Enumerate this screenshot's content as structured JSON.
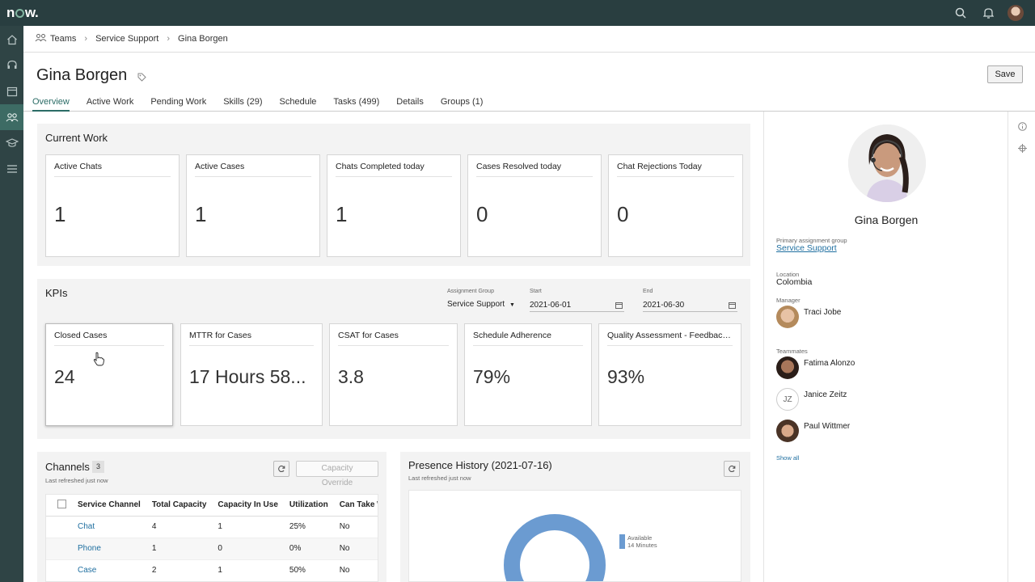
{
  "topbar": {
    "logo": "now",
    "icons": [
      "search-icon",
      "bell-icon",
      "user-avatar-icon"
    ]
  },
  "leftnav": {
    "items": [
      "home-icon",
      "headset-icon",
      "calendar-icon",
      "team-icon",
      "graduation-cap-icon",
      "list-icon"
    ],
    "active_index": 3
  },
  "breadcrumb": {
    "items": [
      "Teams",
      "Service Support",
      "Gina Borgen"
    ]
  },
  "header": {
    "title": "Gina Borgen",
    "save_label": "Save"
  },
  "tabs": [
    {
      "label": "Overview",
      "active": true
    },
    {
      "label": "Active Work"
    },
    {
      "label": "Pending Work"
    },
    {
      "label": "Skills (29)"
    },
    {
      "label": "Schedule"
    },
    {
      "label": "Tasks (499)"
    },
    {
      "label": "Details"
    },
    {
      "label": "Groups (1)"
    }
  ],
  "current_work": {
    "title": "Current Work",
    "cards": [
      {
        "label": "Active Chats",
        "value": "1"
      },
      {
        "label": "Active Cases",
        "value": "1"
      },
      {
        "label": "Chats Completed today",
        "value": "1"
      },
      {
        "label": "Cases Resolved today",
        "value": "0"
      },
      {
        "label": "Chat Rejections Today",
        "value": "0"
      }
    ]
  },
  "kpis": {
    "title": "KPIs",
    "assignment_group_label": "Assignment Group",
    "assignment_group_value": "Service Support",
    "start_label": "Start",
    "start_value": "2021-06-01",
    "end_label": "End",
    "end_value": "2021-06-30",
    "cards": [
      {
        "label": "Closed Cases",
        "value": "24"
      },
      {
        "label": "MTTR for Cases",
        "value": "17 Hours 58..."
      },
      {
        "label": "CSAT for Cases",
        "value": "3.8"
      },
      {
        "label": "Schedule Adherence",
        "value": "79%"
      },
      {
        "label": "Quality Assessment - Feedback ...",
        "value": "93%"
      }
    ]
  },
  "channels": {
    "title": "Channels",
    "count": "3",
    "refreshed": "Last refreshed just now",
    "capacity_override_label": "Capacity Override",
    "columns": [
      "Service Channel",
      "Total Capacity",
      "Capacity In Use",
      "Utilization",
      "Can Take Wo"
    ],
    "rows": [
      [
        "Chat",
        "4",
        "1",
        "25%",
        "No"
      ],
      [
        "Phone",
        "1",
        "0",
        "0%",
        "No"
      ],
      [
        "Case",
        "2",
        "1",
        "50%",
        "No"
      ]
    ]
  },
  "presence": {
    "title": "Presence History (2021-07-16)",
    "refreshed": "Last refreshed just now",
    "legend_label": "Available",
    "legend_value": "14 Minutes",
    "color": "#6b9bd1"
  },
  "profile": {
    "name": "Gina Borgen",
    "group_label": "Primary assignment group",
    "group_value": "Service Support",
    "location_label": "Location",
    "location_value": "Colombia",
    "manager_label": "Manager",
    "manager_name": "Traci Jobe",
    "teammates_label": "Teammates",
    "teammates": [
      {
        "name": "Fatima Alonzo"
      },
      {
        "name": "Janice Zeitz",
        "initials": "JZ"
      },
      {
        "name": "Paul Wittmer"
      }
    ],
    "show_all": "Show all"
  },
  "colors": {
    "topbar": "#293e40",
    "accent": "#2b6c66",
    "link": "#1f6fa0"
  }
}
